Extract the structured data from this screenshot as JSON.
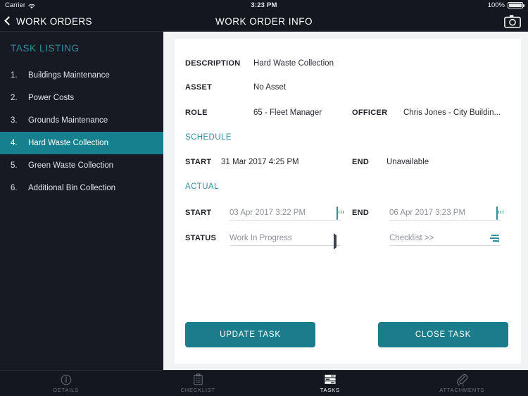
{
  "status_bar": {
    "carrier": "Carrier",
    "wifi_icon": "wifi-icon",
    "time": "3:23 PM",
    "battery_percent": "100%",
    "battery_icon": "battery-full-icon"
  },
  "nav_bar": {
    "back_label": "WORK ORDERS",
    "back_icon": "chevron-left-icon",
    "title": "WORK ORDER INFO",
    "camera_icon": "camera-icon"
  },
  "sidebar": {
    "heading": "TASK LISTING",
    "tasks": [
      {
        "num": "1.",
        "label": "Buildings Maintenance",
        "selected": false
      },
      {
        "num": "2.",
        "label": "Power Costs",
        "selected": false
      },
      {
        "num": "3.",
        "label": "Grounds Maintenance",
        "selected": false
      },
      {
        "num": "4.",
        "label": "Hard Waste Collection",
        "selected": true
      },
      {
        "num": "5.",
        "label": "Green Waste Collection",
        "selected": false
      },
      {
        "num": "6.",
        "label": "Additional Bin Collection",
        "selected": false
      }
    ]
  },
  "form": {
    "description_label": "DESCRIPTION",
    "description_value": "Hard Waste Collection",
    "asset_label": "ASSET",
    "asset_value": "No Asset",
    "role_label": "ROLE",
    "role_value": "65 - Fleet Manager",
    "officer_label": "OFFICER",
    "officer_value": "Chris Jones - City Buildin...",
    "schedule_heading": "SCHEDULE",
    "schedule_start_label": "START",
    "schedule_start_value": "31 Mar 2017 4:25 PM",
    "schedule_end_label": "END",
    "schedule_end_value": "Unavailable",
    "actual_heading": "ACTUAL",
    "actual_start_label": "START",
    "actual_start_value": "03 Apr 2017 3:22 PM",
    "actual_start_icon": "calendar-icon",
    "actual_end_label": "END",
    "actual_end_value": "06 Apr 2017 3:23 PM",
    "actual_end_icon": "calendar-icon",
    "status_label": "STATUS",
    "status_value": "Work In Progress",
    "status_icon": "caret-right-icon",
    "checklist_value": "Checklist >>",
    "checklist_icon": "checklist-icon"
  },
  "actions": {
    "update_label": "UPDATE TASK",
    "close_label": "CLOSE TASK"
  },
  "tab_bar": {
    "tabs": [
      {
        "label": "DETAILS",
        "icon": "info-circle-icon",
        "active": false
      },
      {
        "label": "CHECKLIST",
        "icon": "clipboard-icon",
        "active": false
      },
      {
        "label": "TASKS",
        "icon": "tasks-icon",
        "active": true
      },
      {
        "label": "ATTACHMENTS",
        "icon": "paperclip-icon",
        "active": false
      }
    ]
  },
  "colors": {
    "accent_teal": "#1b7d8b",
    "heading_teal": "#2f8e9e",
    "dark_bg": "#15171f",
    "sidebar_bg": "#171a23",
    "panel_bg": "#f2f3f5",
    "card_bg": "#ffffff"
  }
}
